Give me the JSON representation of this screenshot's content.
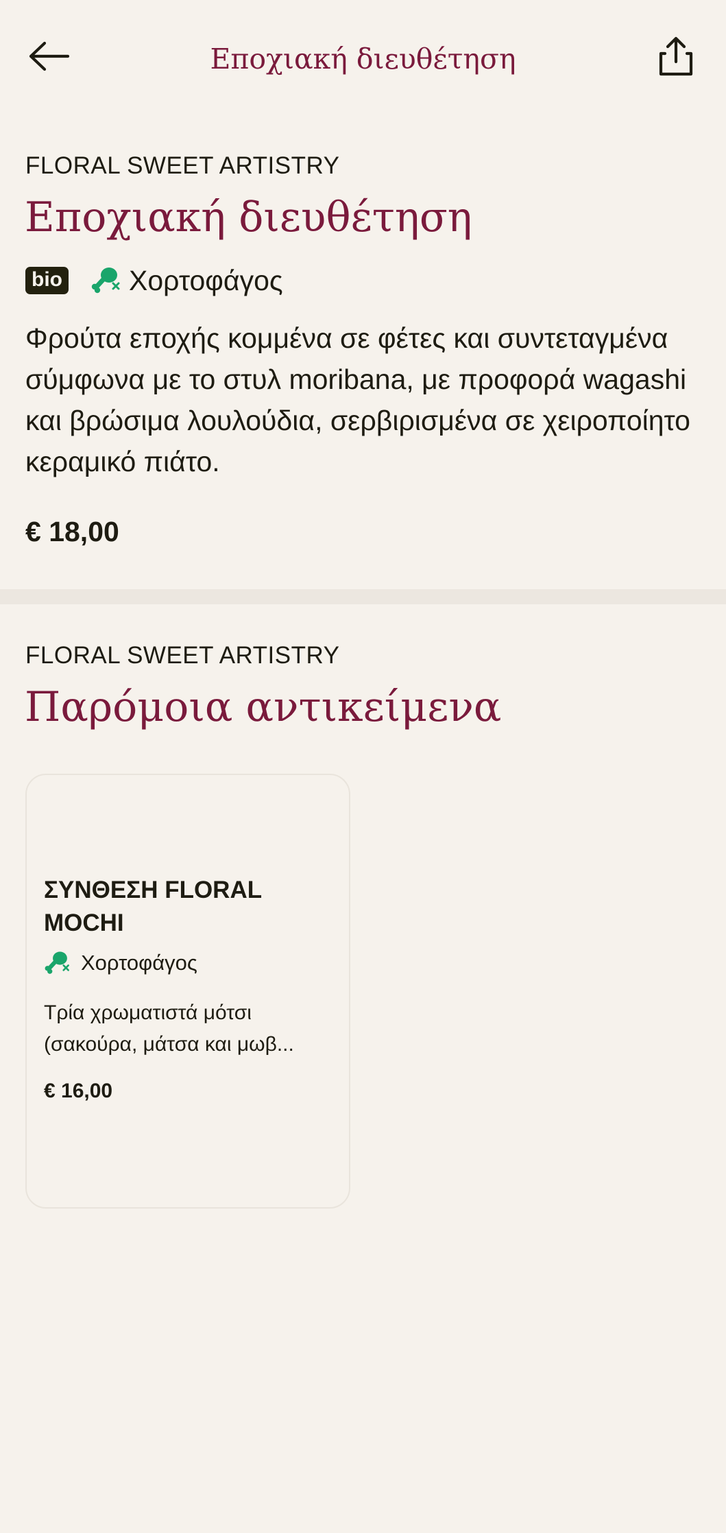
{
  "header": {
    "title": "Εποχιακή διευθέτηση",
    "back_icon": "arrow-left-icon",
    "share_icon": "share-icon"
  },
  "product": {
    "brand": "FLORAL SWEET ARTISTRY",
    "name": "Εποχιακή διευθέτηση",
    "badge": "bio",
    "diet_label": "Χορτοφάγος",
    "diet_icon": "vegetarian-drumstick-crossed-icon",
    "description": "Φρούτα εποχής κομμένα σε φέτες και συντεταγμένα σύμφωνα με το στυλ moribana, με προφορά wagashi και βρώσιμα λουλούδια, σερβιρισμένα σε χειροποίητο κεραμικό πιάτο.",
    "price": "€ 18,00"
  },
  "similar": {
    "brand": "FLORAL SWEET ARTISTRY",
    "heading": "Παρόμοια αντικείμενα",
    "items": [
      {
        "title": "ΣΥΝΘΕΣΗ FLORAL MOCHI",
        "diet_label": "Χορτοφάγος",
        "description_line1": "Τρία χρωματιστά μότσι",
        "description_line2": "(σακούρα, μάτσα και μωβ...",
        "price": "€ 16,00"
      }
    ]
  },
  "colors": {
    "background": "#f6f2ec",
    "accent": "#7a1a3c",
    "text": "#1e1c12",
    "vegetarian_green": "#1aa56b",
    "divider": "#ece7e0"
  }
}
